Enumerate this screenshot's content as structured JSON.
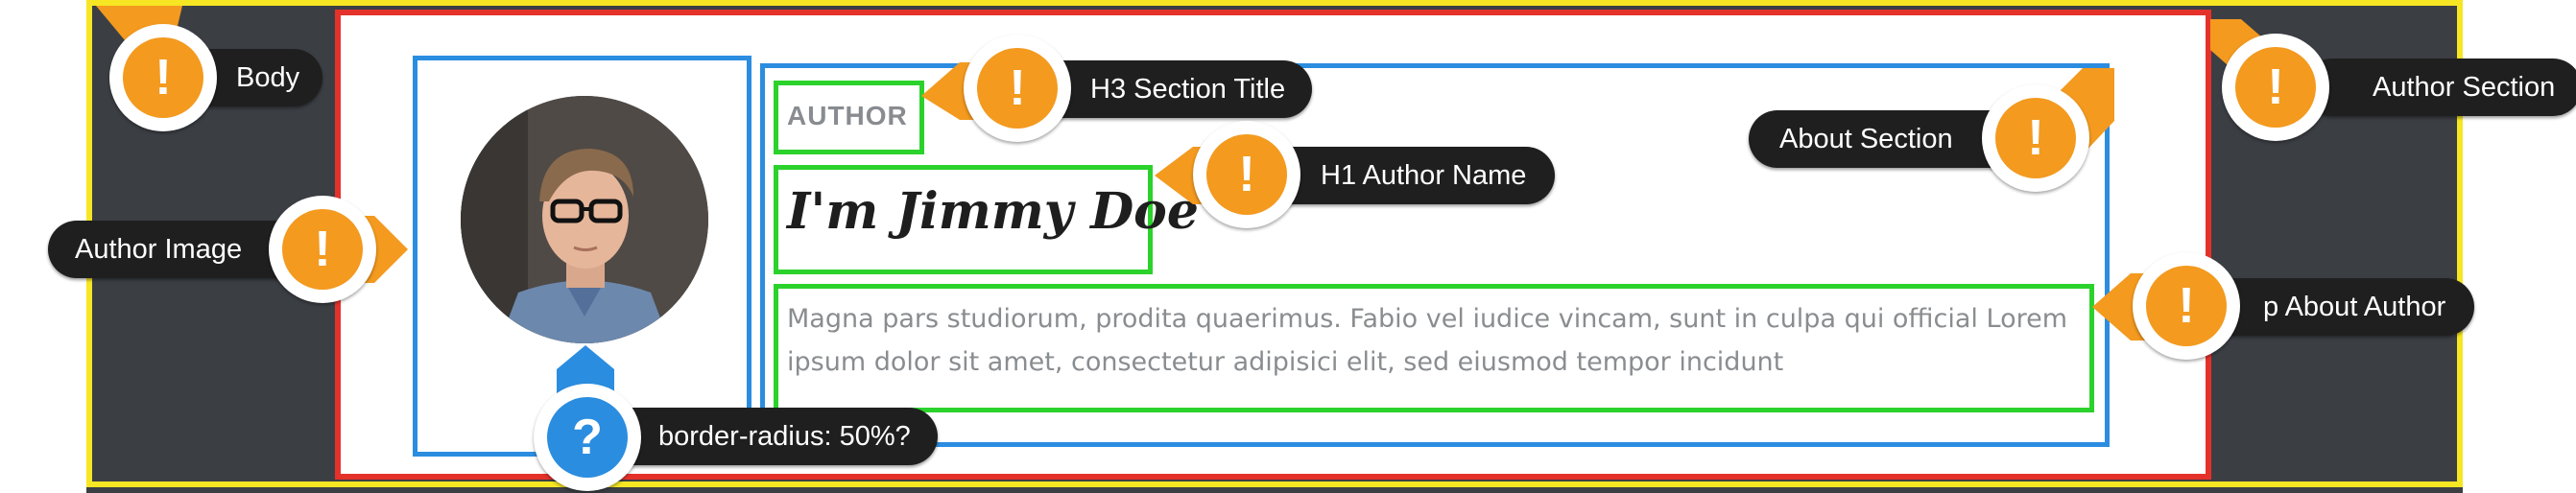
{
  "author": {
    "section_title": "AUTHOR",
    "name": "I'm Jimmy Doe",
    "about": "Magna pars studiorum, prodita quaerimus. Fabio vel iudice vincam, sunt in culpa qui official Lorem ipsum dolor sit amet, consectetur adipisici elit, sed eiusmod tempor incidunt"
  },
  "annotations": {
    "body": "Body",
    "author_image": "Author Image",
    "h3_section_title": "H3 Section Title",
    "h1_author_name": "H1 Author Name",
    "about_section": "About Section",
    "author_section": "Author Section",
    "p_about_author": "p About Author",
    "border_radius": "border-radius: 50%?",
    "warning_symbol": "!",
    "question_symbol": "?"
  },
  "colors": {
    "body_outline": "#f6e623",
    "section_outline": "#e4322b",
    "column_outline": "#2b8de0",
    "element_outline": "#2bd22b",
    "warning_badge": "#f39a1f",
    "question_badge": "#2b8de0",
    "page_background": "#3b3f44"
  },
  "icons": [
    "warning-icon",
    "question-icon"
  ]
}
